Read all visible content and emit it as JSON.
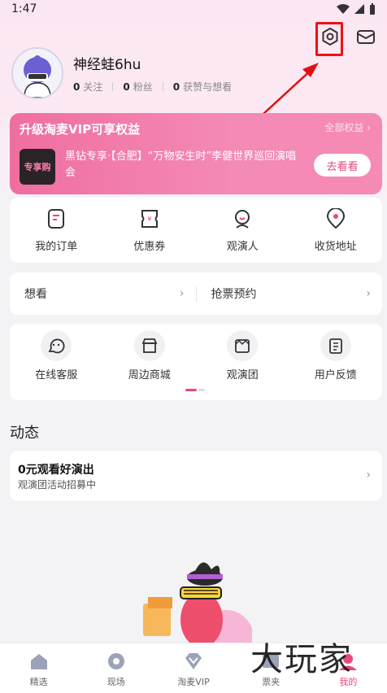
{
  "status_bar": {
    "time": "1:47"
  },
  "profile": {
    "username": "神经蛙6hu",
    "stats": [
      {
        "count": "0",
        "label": "关注"
      },
      {
        "count": "0",
        "label": "粉丝"
      },
      {
        "count": "0",
        "label": "获赞与想看"
      }
    ]
  },
  "vip": {
    "title": "升级淘麦VIP可享权益",
    "all_link": "全部权益 ›",
    "thumb_text": "专享购",
    "desc": "黑钻专享·【合肥】“万物安生时”李健世界巡回演唱会",
    "button": "去看看"
  },
  "quick_grid": [
    {
      "label": "我的订单",
      "icon": "order-icon"
    },
    {
      "label": "优惠券",
      "icon": "coupon-icon"
    },
    {
      "label": "观演人",
      "icon": "viewer-icon"
    },
    {
      "label": "收货地址",
      "icon": "address-icon"
    }
  ],
  "want_row": {
    "left": "想看",
    "right": "抢票预约"
  },
  "service_grid": [
    {
      "label": "在线客服",
      "icon": "service-icon"
    },
    {
      "label": "周边商城",
      "icon": "shop-icon"
    },
    {
      "label": "观演团",
      "icon": "group-icon"
    },
    {
      "label": "用户反馈",
      "icon": "feedback-icon"
    }
  ],
  "feed": {
    "section_title": "动态",
    "card_title": "0元观看好演出",
    "card_sub": "观演团活动招募中"
  },
  "tabbar": [
    {
      "label": "精选"
    },
    {
      "label": "现场"
    },
    {
      "label": "淘麦VIP"
    },
    {
      "label": "票夹"
    },
    {
      "label": "我的"
    }
  ],
  "watermark": "大玩家",
  "colors": {
    "accent": "#e9477f",
    "vip_gradient_start": "#ef6ea0",
    "annotation": "#e11111"
  }
}
